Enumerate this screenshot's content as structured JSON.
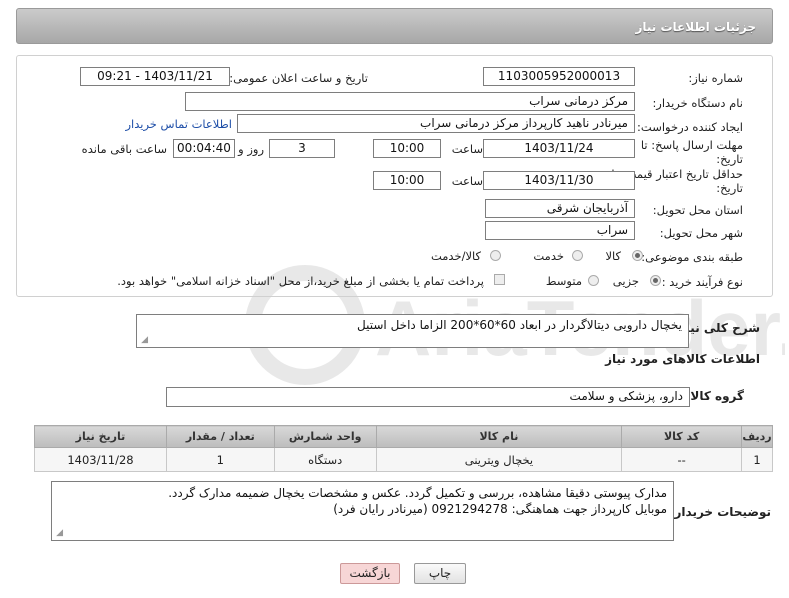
{
  "header": {
    "title": "جزئیات اطلاعات نیاز"
  },
  "form": {
    "need_number_label": "شماره نیاز:",
    "need_number": "1103005952000013",
    "announce_label": "تاریخ و ساعت اعلان عمومی:",
    "announce_value": "1403/11/21 - 09:21",
    "buyer_org_label": "نام دستگاه خریدار:",
    "buyer_org": "مرکز درمانی سراب",
    "creator_label": "ایجاد کننده درخواست:",
    "creator": "میرنادر ناهید کارپرداز مرکز درمانی سراب",
    "contact_link": "اطلاعات تماس خریدار",
    "deadline_label_1": "مهلت ارسال پاسخ: تا",
    "deadline_label_2": "تاریخ:",
    "deadline_date": "1403/11/24",
    "time_label": "ساعت",
    "deadline_time": "10:00",
    "days": "3",
    "days_label": "روز و",
    "remaining": "00:04:40",
    "remaining_label": "ساعت باقی مانده",
    "validity_label_1": "حداقل تاریخ اعتبار قیمت: تا",
    "validity_label_2": "تاریخ:",
    "validity_date": "1403/11/30",
    "validity_time": "10:00",
    "province_label": "استان محل تحویل:",
    "province": "آذربایجان شرقی",
    "city_label": "شهر محل تحویل:",
    "city": "سراب",
    "category_label": "طبقه بندی موضوعی:",
    "category_options": [
      "کالا",
      "خدمت",
      "کالا/خدمت"
    ],
    "category_selected": "کالا",
    "process_label": "نوع فرآیند خرید :",
    "process_options": [
      "جزیی",
      "متوسط"
    ],
    "process_selected": "جزیی",
    "payment_note": "پرداخت تمام یا بخشی از مبلغ خرید،از محل \"اسناد خزانه اسلامی\" خواهد بود."
  },
  "description": {
    "label": "شرح کلی نیاز:",
    "value": "یخچال دارویی دیتالاگردار در ابعاد 60*60*200 الزاما داخل استیل"
  },
  "goods_section": {
    "title": "اطلاعات کالاهای مورد نیاز"
  },
  "goods_group": {
    "label": "گروه کالا:",
    "value": "دارو، پزشکی و سلامت"
  },
  "table": {
    "headers": [
      "ردیف",
      "کد کالا",
      "نام کالا",
      "واحد شمارش",
      "تعداد / مقدار",
      "تاریخ نیاز"
    ],
    "rows": [
      [
        "1",
        "--",
        "یخچال ویترینی",
        "دستگاه",
        "1",
        "1403/11/28"
      ]
    ]
  },
  "buyer_notes": {
    "label": "توضیحات خریدار:",
    "line1": "مدارک پیوستی دقیقا مشاهده، بررسی و تکمیل گردد. عکس و مشخصات یخچال ضمیمه مدارک گردد.",
    "line2": "موبایل کارپرداز جهت هماهنگی: 0921294278 (میرنادر رایان فرد)"
  },
  "buttons": {
    "print": "چاپ",
    "back": "بازگشت"
  },
  "watermark": {
    "text": "AriaTender.neT"
  },
  "colors": {
    "link": "#1f4fa8",
    "back_button_bg": "#f7d6d6"
  }
}
